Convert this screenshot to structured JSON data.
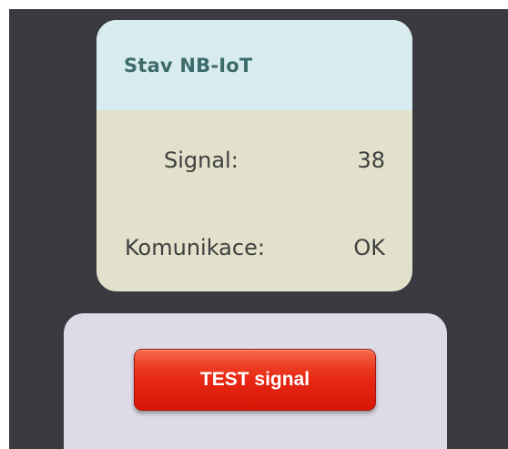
{
  "status_card": {
    "title": "Stav NB-IoT",
    "rows": [
      {
        "label": "Signal:",
        "value": "38"
      },
      {
        "label": "Komunikace:",
        "value": "OK"
      }
    ]
  },
  "test_panel": {
    "button_label": "TEST signal"
  },
  "colors": {
    "background": "#3b3a40",
    "card_header": "#d8ecef",
    "card_body": "#e2e1cb",
    "panel": "#dddce6",
    "button": "#e62411"
  }
}
